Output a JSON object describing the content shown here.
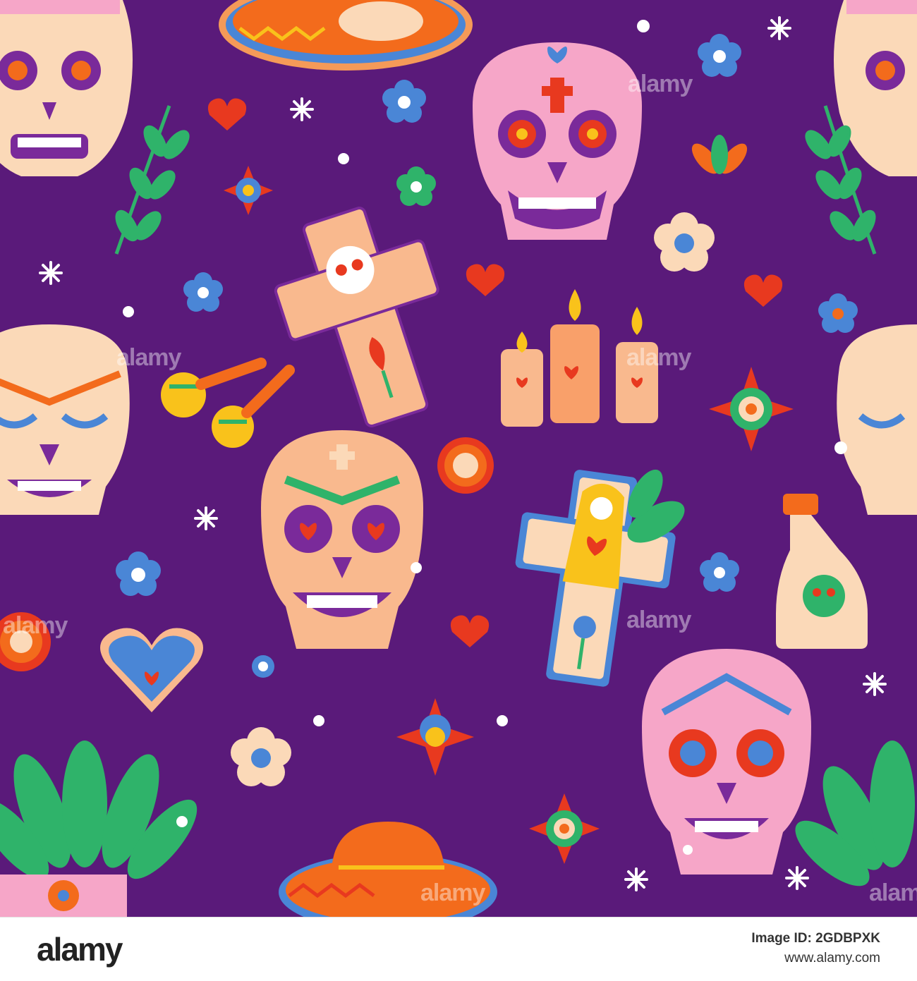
{
  "colors": {
    "background": "#5a1a7a",
    "skull_cream": "#fbd9b8",
    "skull_pink": "#f6a6c8",
    "skull_orange": "#f9b98e",
    "orange": "#f36b1c",
    "red": "#e8391f",
    "blue": "#4a86d6",
    "green": "#2fb36a",
    "yellow": "#f9c21b"
  },
  "watermark": {
    "text": "alamy"
  },
  "footer": {
    "logo": "alamy",
    "image_id_label": "Image ID:",
    "image_id": "2GDBPXK",
    "site": "www.alamy.com"
  }
}
